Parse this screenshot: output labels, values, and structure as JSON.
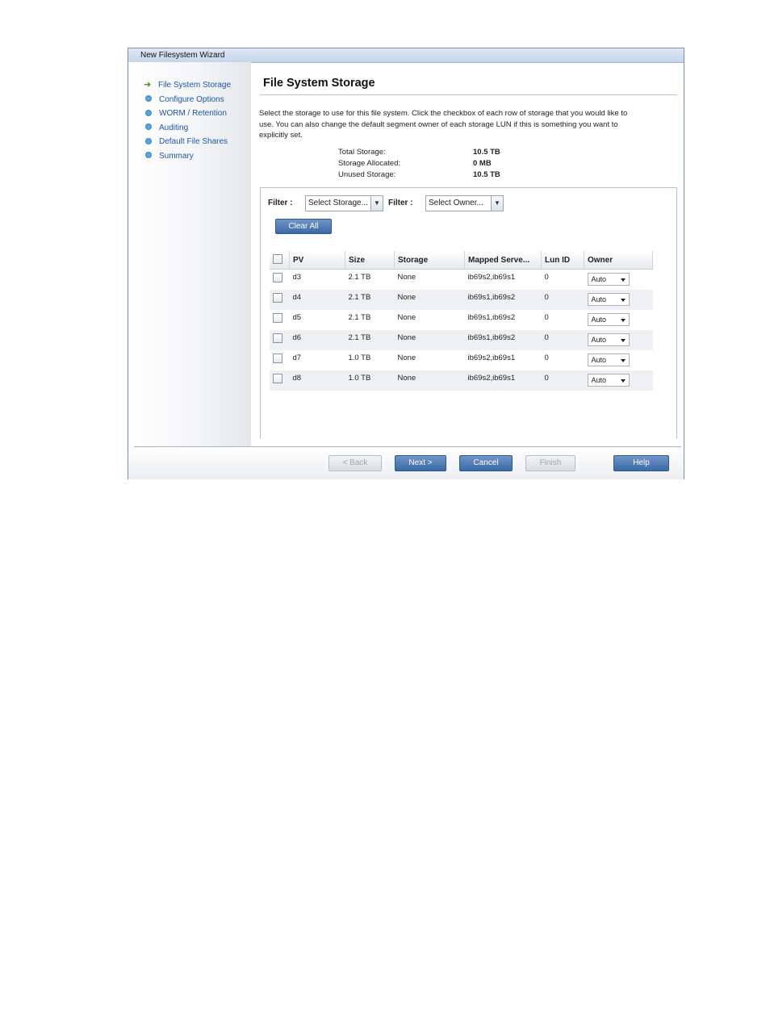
{
  "window": {
    "title": "New Filesystem Wizard"
  },
  "sidebar": {
    "items": [
      {
        "label": "File System Storage",
        "current": true
      },
      {
        "label": "Configure Options"
      },
      {
        "label": "WORM / Retention"
      },
      {
        "label": "Auditing"
      },
      {
        "label": "Default File Shares"
      },
      {
        "label": "Summary"
      }
    ]
  },
  "main": {
    "title": "File System Storage",
    "description": "Select the storage to use for this file system. Click the checkbox of each row of storage that you would like to use. You can also change the default segment owner of each storage LUN if this is something you want to explicitly set.",
    "summary": [
      {
        "label": "Total Storage:",
        "value": "10.5 TB"
      },
      {
        "label": "Storage Allocated:",
        "value": "0 MB"
      },
      {
        "label": "Unused Storage:",
        "value": "10.5 TB"
      }
    ],
    "filter1_label": "Filter :",
    "filter1_value": "Select Storage...",
    "filter2_label": "Filter :",
    "filter2_value": "Select Owner...",
    "clear_all": "Clear All",
    "columns": [
      "PV",
      "Size",
      "Storage",
      "Mapped Serve...",
      "Lun ID",
      "Owner"
    ],
    "rows": [
      {
        "pv": "d3",
        "size": "2.1 TB",
        "storage": "None",
        "mapped": "ib69s2,ib69s1",
        "lun": "0",
        "owner": "Auto"
      },
      {
        "pv": "d4",
        "size": "2.1 TB",
        "storage": "None",
        "mapped": "ib69s1,ib69s2",
        "lun": "0",
        "owner": "Auto"
      },
      {
        "pv": "d5",
        "size": "2.1 TB",
        "storage": "None",
        "mapped": "ib69s1,ib69s2",
        "lun": "0",
        "owner": "Auto"
      },
      {
        "pv": "d6",
        "size": "2.1 TB",
        "storage": "None",
        "mapped": "ib69s1,ib69s2",
        "lun": "0",
        "owner": "Auto"
      },
      {
        "pv": "d7",
        "size": "1.0 TB",
        "storage": "None",
        "mapped": "ib69s2,ib69s1",
        "lun": "0",
        "owner": "Auto"
      },
      {
        "pv": "d8",
        "size": "1.0 TB",
        "storage": "None",
        "mapped": "ib69s2,ib69s1",
        "lun": "0",
        "owner": "Auto"
      }
    ]
  },
  "footer": {
    "back": "< Back",
    "next": "Next >",
    "cancel": "Cancel",
    "finish": "Finish",
    "help": "Help"
  },
  "colors": {
    "accent": "#3b6aa8",
    "link": "#1f55a8",
    "current_arrow": "#3c9a1e"
  }
}
